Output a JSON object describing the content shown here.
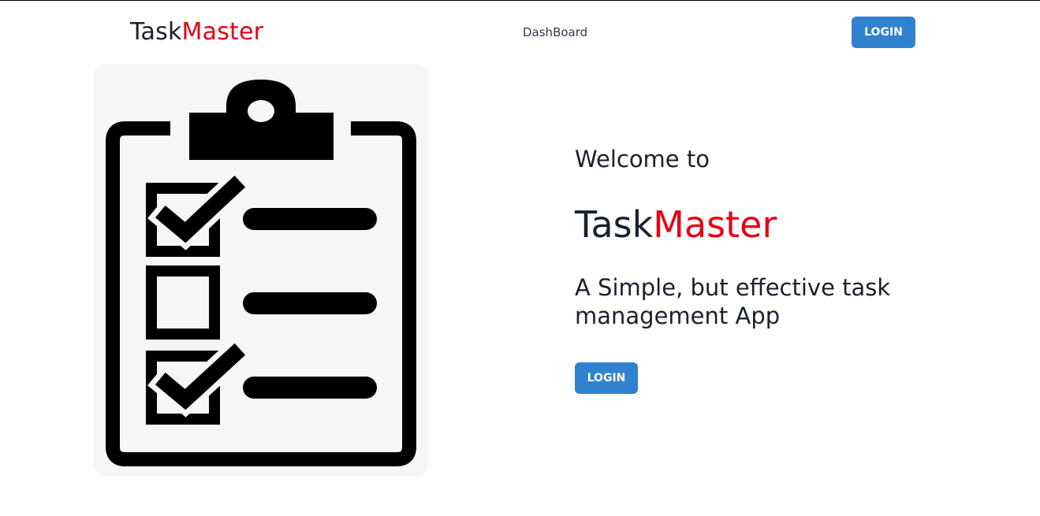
{
  "header": {
    "brand": {
      "part1": "Task",
      "part2": "Master"
    },
    "nav": {
      "dashboard_label": "DashBoard"
    },
    "login_label": "LOGIN"
  },
  "hero": {
    "welcome": "Welcome to",
    "title": {
      "part1": "Task",
      "part2": "Master"
    },
    "tagline": "A Simple, but effective task management App",
    "login_label": "LOGIN"
  },
  "illustration": {
    "icon": "clipboard-checklist-icon",
    "items": [
      {
        "checked": true
      },
      {
        "checked": false
      },
      {
        "checked": true
      }
    ]
  },
  "colors": {
    "accent": "#3182ce",
    "brand_red": "#e60012",
    "text_dark": "#1a202c",
    "panel_bg": "#f6f6f6"
  }
}
